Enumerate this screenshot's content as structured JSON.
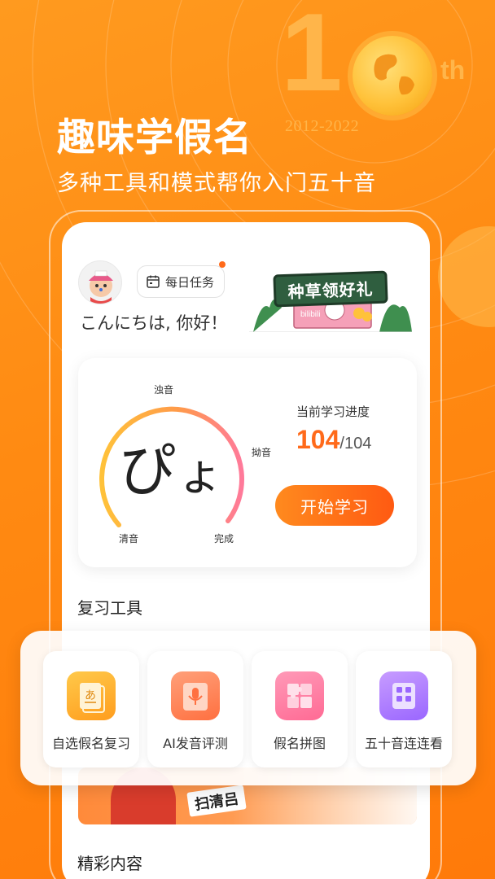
{
  "hero": {
    "anniversary_number": "1",
    "anniversary_suffix": "th",
    "anniversary_years": "2012-2022",
    "title": "趣味学假名",
    "subtitle": "多种工具和模式帮你入门五十音"
  },
  "header": {
    "task_label": "每日任务",
    "greeting": "こんにちは, 你好！",
    "promo_text": "种草领好礼",
    "promo_brand": "bilibili"
  },
  "progress": {
    "kana_main": "ぴ",
    "kana_small": "ょ",
    "label_top": "浊音",
    "label_right": "拗音",
    "label_left": "清音",
    "label_bottom": "完成",
    "title": "当前学习进度",
    "current": "104",
    "total": "/104",
    "start_button": "开始学习"
  },
  "sections": {
    "review_tools": "复习工具",
    "featured": "精彩内容"
  },
  "tools": [
    {
      "label": "自选假名复习",
      "icon": "kana-card-icon",
      "color": "#ffb13a"
    },
    {
      "label": "AI发音评测",
      "icon": "microphone-icon",
      "color": "#ff8a5a"
    },
    {
      "label": "假名拼图",
      "icon": "puzzle-icon",
      "color": "#ff7aa0"
    },
    {
      "label": "五十音连连看",
      "icon": "grid-match-icon",
      "color": "#b07aff"
    }
  ],
  "banner": {
    "tag_text": "扫清吕"
  },
  "colors": {
    "accent": "#ff6a1a",
    "background": "#ff8a12"
  }
}
